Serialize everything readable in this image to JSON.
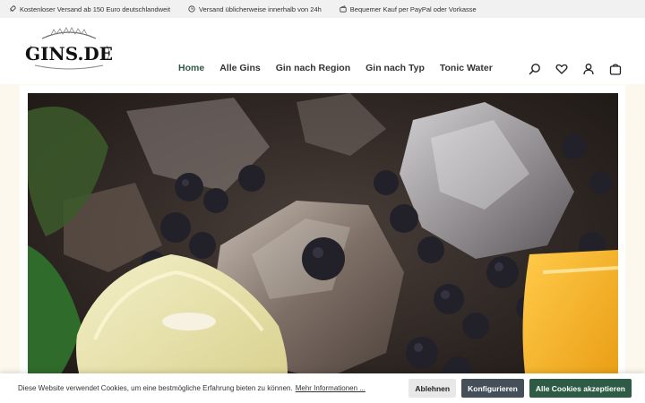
{
  "topbar": {
    "items": [
      {
        "icon": "rocket-icon",
        "text": "Kostenloser Versand ab 150 Euro deutschlandweit"
      },
      {
        "icon": "clock-icon",
        "text": "Versand üblicherweise innerhalb von 24h"
      },
      {
        "icon": "wallet-icon",
        "text": "Bequemer Kauf per PayPal oder Vorkasse"
      }
    ]
  },
  "header": {
    "logo_text": "GINS.DE",
    "nav": [
      "Home",
      "Alle Gins",
      "Gin nach Region",
      "Gin nach Typ",
      "Tonic Water"
    ],
    "active_nav": "Home",
    "icons": [
      "search-icon",
      "heart-icon",
      "user-icon",
      "bag-icon"
    ]
  },
  "cookie": {
    "text": "Diese Website verwendet Cookies, um eine bestmögliche Erfahrung bieten zu können.",
    "link": "Mehr Informationen ...",
    "reject": "Ablehnen",
    "configure": "Konfigurieren",
    "accept": "Alle Cookies akzeptieren"
  },
  "colors": {
    "accent": "#2e5b45",
    "dark_button": "#444f59",
    "cream": "#fdf8ee"
  }
}
